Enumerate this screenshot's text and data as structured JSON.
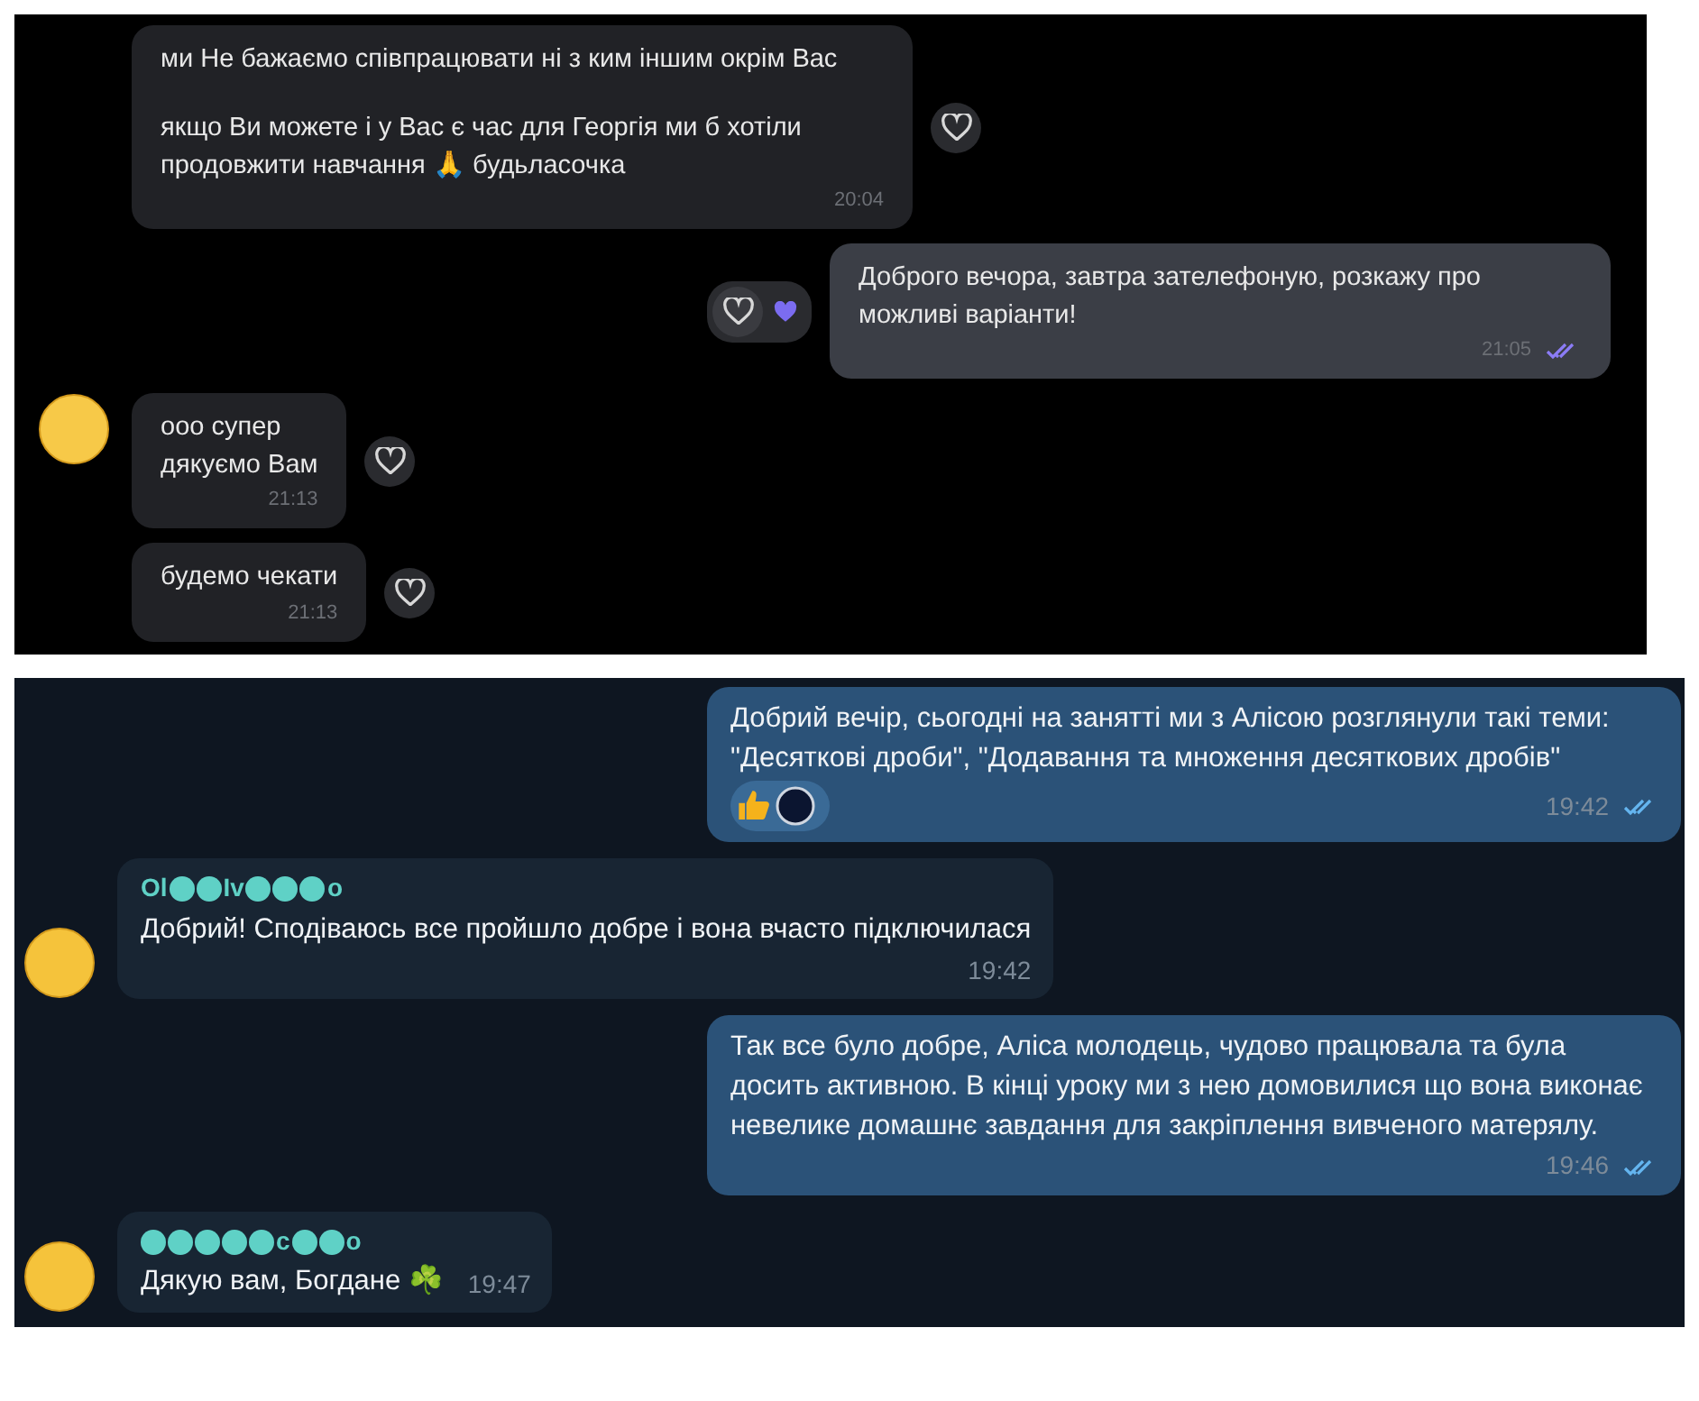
{
  "panels": [
    {
      "kind": "dark",
      "messages": [
        {
          "kind": "incoming",
          "avatar": false,
          "paragraphs": [
            "ми Не бажаємо співпрацювати ні з ким іншим окрім Вас",
            "якщо Ви можете і у Вас є час для Георгія ми б хотіли продовжити навчання 🙏 будьласочка"
          ],
          "time": "20:04",
          "reactions": [
            {
              "kind": "heart",
              "selected": false
            }
          ]
        },
        {
          "kind": "outgoing",
          "avatar": false,
          "paragraphs": [
            "Доброго вечора, завтра зателефоную, розкажу про можливі варіанти!"
          ],
          "time": "21:05",
          "read": true,
          "reactions": [
            {
              "kind": "heart",
              "selected": false
            },
            {
              "kind": "heart",
              "selected": true
            }
          ]
        },
        {
          "kind": "incoming",
          "avatar": true,
          "paragraphs": [
            "ооо супер\nдякуємо Вам"
          ],
          "time": "21:13",
          "reactions": [
            {
              "kind": "heart",
              "selected": false
            }
          ]
        },
        {
          "kind": "incoming",
          "avatar": false,
          "paragraphs": [
            "будемо чекати"
          ],
          "time": "21:13",
          "reactions": [
            {
              "kind": "heart",
              "selected": false
            }
          ]
        }
      ]
    },
    {
      "kind": "navy",
      "messages": [
        {
          "kind": "outgoing",
          "avatar": false,
          "paragraphs": [
            "Добрий вечір, сьогодні на занятті ми з Алісою розглянули такі теми:  \"Десяткові дроби\", \"Додавання та множення десяткових дробів\""
          ],
          "time": "19:42",
          "read": true,
          "reactions": [
            {
              "kind": "thumbs"
            },
            {
              "kind": "user"
            }
          ]
        },
        {
          "kind": "incoming",
          "avatar": true,
          "sender": [
            {
              "kind": "text",
              "text": "Ol"
            },
            {
              "kind": "blob"
            },
            {
              "kind": "blob"
            },
            {
              "kind": "text",
              "text": "Iv"
            },
            {
              "kind": "blob"
            },
            {
              "kind": "blob"
            },
            {
              "kind": "blob"
            },
            {
              "kind": "text",
              "text": "o"
            }
          ],
          "paragraphs": [
            "Добрий! Сподіваюсь все пройшло добре і вона вчасто підключилася"
          ],
          "time": "19:42"
        },
        {
          "kind": "outgoing",
          "avatar": false,
          "paragraphs": [
            "Так все було добре, Аліса молодець, чудово працювала та була досить активною. В кінці уроку ми з нею домовилися що вона виконає невелике домашнє завдання для закріплення вивченого матерялу."
          ],
          "time": "19:46",
          "read": true
        },
        {
          "kind": "incoming",
          "avatar": true,
          "sender": [
            {
              "kind": "blob"
            },
            {
              "kind": "blob"
            },
            {
              "kind": "blob"
            },
            {
              "kind": "blob"
            },
            {
              "kind": "blob"
            },
            {
              "kind": "text",
              "text": "c"
            },
            {
              "kind": "blob"
            },
            {
              "kind": "blob"
            },
            {
              "kind": "text",
              "text": "o"
            }
          ],
          "paragraphs": [
            "Дякую вам, Богдане ☘️"
          ],
          "time": "19:47",
          "inline_time": true
        }
      ]
    }
  ]
}
